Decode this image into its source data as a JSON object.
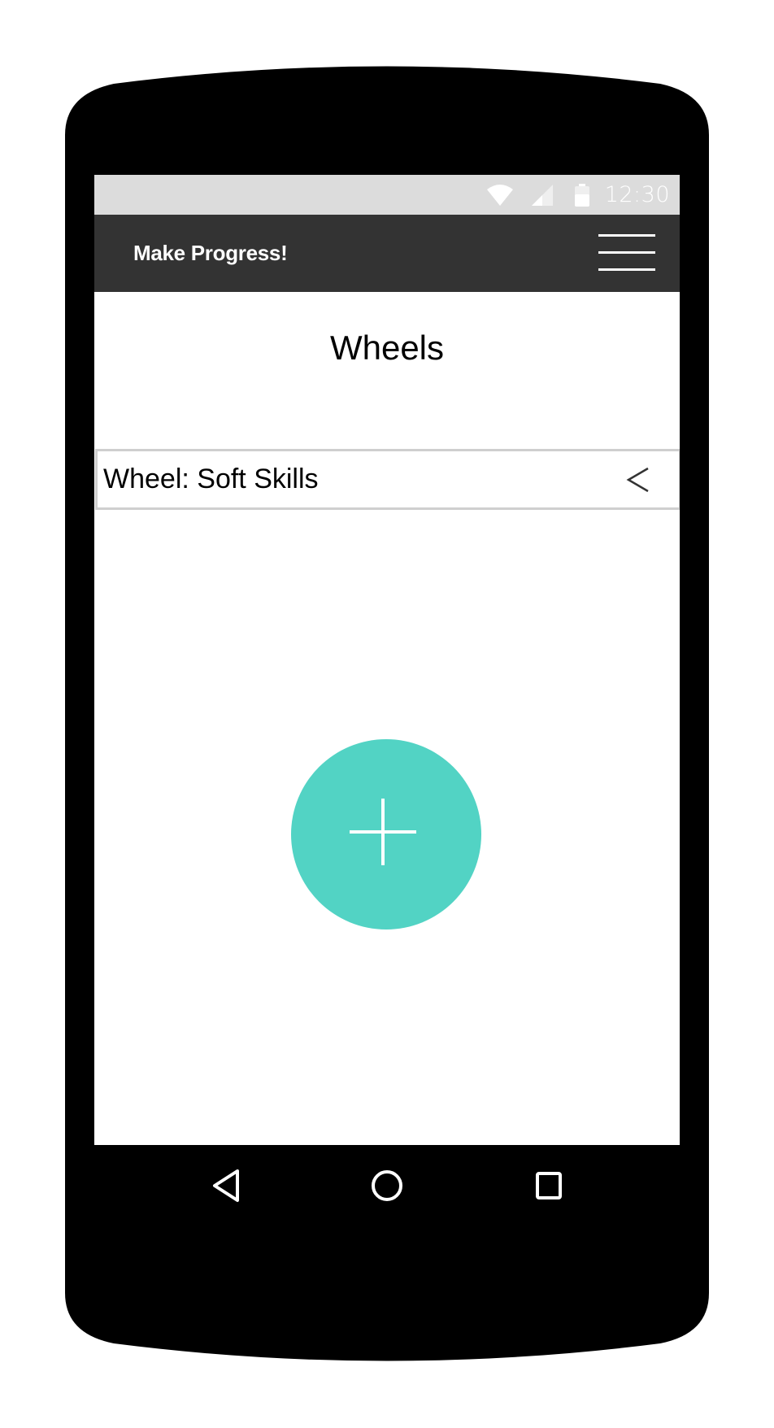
{
  "status_bar": {
    "time": "12:30",
    "icons": [
      "wifi-icon",
      "signal-icon",
      "battery-icon"
    ]
  },
  "app_bar": {
    "title": "Make Progress!",
    "menu_icon": "hamburger-menu-icon"
  },
  "main": {
    "page_title": "Wheels",
    "list_items": [
      {
        "label": "Wheel: Soft Skills",
        "icon": "chevron-left-icon"
      }
    ],
    "fab": {
      "icon": "plus-icon"
    }
  },
  "nav_bar": {
    "buttons": [
      "back-icon",
      "home-icon",
      "recents-icon"
    ]
  },
  "colors": {
    "status_bar": "#dcdcdc",
    "app_bar": "#333333",
    "fab": "#52d3c4",
    "device": "#000000"
  }
}
